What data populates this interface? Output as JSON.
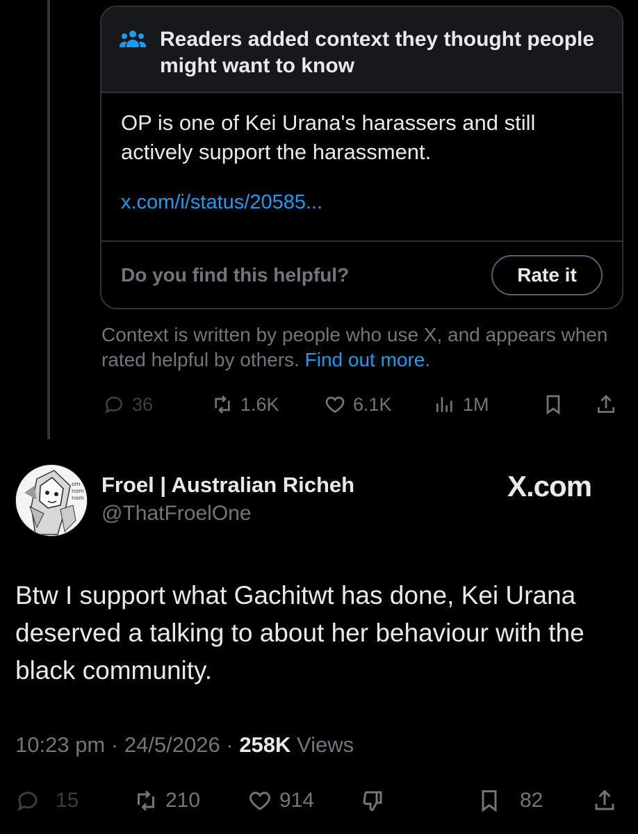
{
  "note": {
    "title": "Readers added context they thought people might want to know",
    "body": "OP is one of Kei Urana's harassers and still actively support the harassment.",
    "link": "x.com/i/status/20585...",
    "helpful_question": "Do you find this helpful?",
    "rate_label": "Rate it",
    "info_text": "Context is written by people who use X, and appears when rated helpful by others.",
    "info_link": "Find out more",
    "info_end": "."
  },
  "parent_actions": {
    "replies": "36",
    "reposts": "1.6K",
    "likes": "6.1K",
    "views": "1M"
  },
  "tweet": {
    "author_name": "Froel | Australian Richeh",
    "author_handle": "@ThatFroelOne",
    "watermark": "X.com",
    "text": "Btw I support what Gachitwt has done, Kei Urana deserved a talking to about her behaviour with the black community.",
    "time": "10:23 pm",
    "sep1": " · ",
    "date": "24/5/2026",
    "sep2": " · ",
    "views_count": "258K",
    "views_label": " Views"
  },
  "tweet_actions": {
    "replies": "15",
    "reposts": "210",
    "likes": "914",
    "bookmarks": "82"
  },
  "colors": {
    "background": "#000000",
    "text": "#e7e9ea",
    "muted": "#71767b",
    "link": "#1d9bf0",
    "border": "#2f3336"
  }
}
